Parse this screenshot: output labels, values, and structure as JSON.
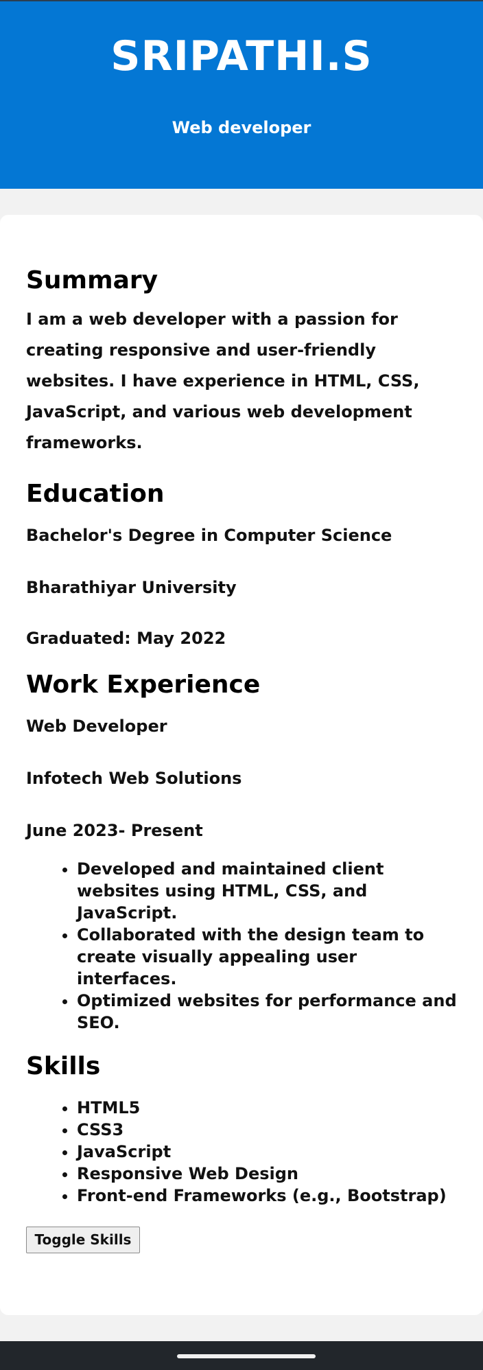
{
  "header": {
    "name": "SRIPATHI.S",
    "role": "Web developer"
  },
  "summary": {
    "title": "Summary",
    "text": "I am a web developer with a passion for creating responsive and user-friendly websites. I have experience in HTML, CSS, JavaScript, and various web development frameworks."
  },
  "education": {
    "title": "Education",
    "degree": "Bachelor's Degree in Computer Science",
    "university": "Bharathiyar University",
    "graduated": "Graduated: May 2022"
  },
  "work_experience": {
    "title": "Work Experience",
    "job_title": "Web Developer",
    "company": "Infotech Web Solutions",
    "dates": "June 2023- Present",
    "responsibilities": [
      "Developed and maintained client websites using HTML, CSS, and JavaScript.",
      "Collaborated with the design team to create visually appealing user interfaces.",
      "Optimized websites for performance and SEO."
    ]
  },
  "skills": {
    "title": "Skills",
    "items": [
      "HTML5",
      "CSS3",
      "JavaScript",
      "Responsive Web Design",
      "Front-end Frameworks (e.g., Bootstrap)"
    ],
    "toggle_label": "Toggle Skills"
  },
  "colors": {
    "header_background": "#0477d4",
    "card_background": "#ffffff",
    "page_background": "#f2f2f2",
    "text": "#111111",
    "button_background": "#efefef",
    "navigation_bar": "#22262b"
  }
}
